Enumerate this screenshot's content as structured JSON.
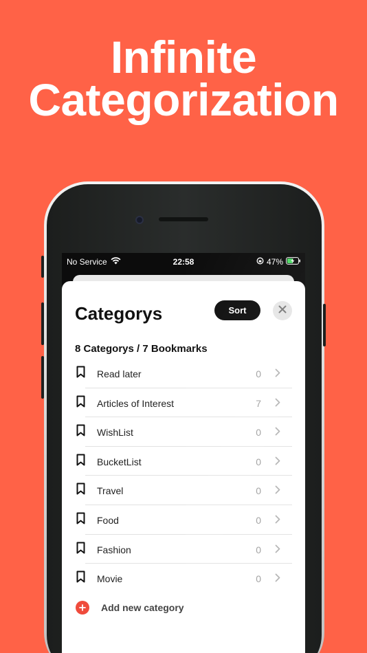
{
  "headline": {
    "line1": "Infinite",
    "line2": "Categorization"
  },
  "status_bar": {
    "carrier": "No Service",
    "time": "22:58",
    "battery": "47%"
  },
  "sheet": {
    "title": "Categorys",
    "sort_label": "Sort",
    "summary": "8 Categorys / 7 Bookmarks",
    "categories": [
      {
        "label": "Read later",
        "count": "0"
      },
      {
        "label": "Articles of Interest",
        "count": "7"
      },
      {
        "label": "WishList",
        "count": "0"
      },
      {
        "label": "BucketList",
        "count": "0"
      },
      {
        "label": "Travel",
        "count": "0"
      },
      {
        "label": "Food",
        "count": "0"
      },
      {
        "label": "Fashion",
        "count": "0"
      },
      {
        "label": "Movie",
        "count": "0"
      }
    ],
    "add_label": "Add new category"
  },
  "colors": {
    "background": "#FF6247",
    "accent": "#ef4b3c"
  },
  "icons": [
    "wifi-icon",
    "orientation-lock-icon",
    "battery-charging-icon",
    "close-icon",
    "bookmark-icon",
    "chevron-right-icon",
    "plus-icon"
  ]
}
